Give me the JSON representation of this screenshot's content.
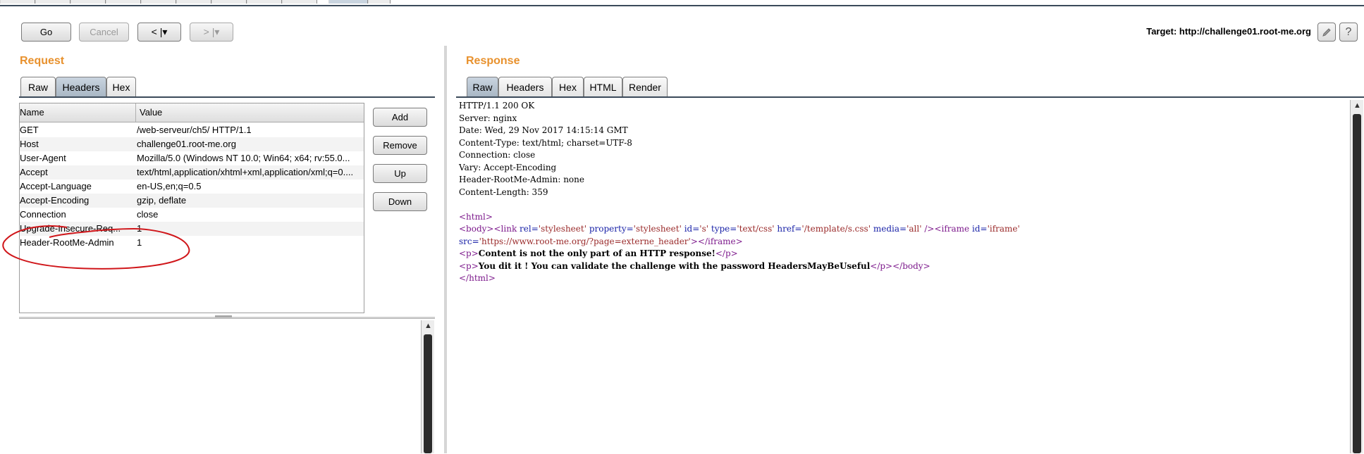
{
  "toolbar": {
    "go": "Go",
    "cancel": "Cancel",
    "back": "< |▾",
    "forward": "> |▾",
    "target_label": "Target: http://challenge01.root-me.org",
    "edit_icon": "pencil-icon",
    "help": "?"
  },
  "request": {
    "title": "Request",
    "tabs": [
      "Raw",
      "Headers",
      "Hex"
    ],
    "active_tab": "Headers",
    "columns": [
      "Name",
      "Value"
    ],
    "rows": [
      {
        "name": "GET",
        "value": "/web-serveur/ch5/ HTTP/1.1"
      },
      {
        "name": "Host",
        "value": "challenge01.root-me.org"
      },
      {
        "name": "User-Agent",
        "value": "Mozilla/5.0 (Windows NT 10.0; Win64; x64; rv:55.0..."
      },
      {
        "name": "Accept",
        "value": "text/html,application/xhtml+xml,application/xml;q=0...."
      },
      {
        "name": "Accept-Language",
        "value": "en-US,en;q=0.5"
      },
      {
        "name": "Accept-Encoding",
        "value": "gzip, deflate"
      },
      {
        "name": "Connection",
        "value": "close"
      },
      {
        "name": "Upgrade-Insecure-Req...",
        "value": "1"
      },
      {
        "name": "Header-RootMe-Admin",
        "value": "1"
      }
    ],
    "buttons": [
      "Add",
      "Remove",
      "Up",
      "Down"
    ]
  },
  "response": {
    "title": "Response",
    "tabs": [
      "Raw",
      "Headers",
      "Hex",
      "HTML",
      "Render"
    ],
    "active_tab": "Raw",
    "headers": [
      "HTTP/1.1 200 OK",
      "Server: nginx",
      "Date: Wed, 29 Nov 2017 14:15:14 GMT",
      "Content-Type: text/html; charset=UTF-8",
      "Connection: close",
      "Vary: Accept-Encoding",
      "Header-RootMe-Admin: none",
      "Content-Length: 359"
    ],
    "body": {
      "html_open": "<html>",
      "body_tag": "<body>",
      "link_open": "<link",
      "rel_attr": "rel=",
      "rel_val": "'stylesheet'",
      "property_attr": "property=",
      "property_val": "'stylesheet'",
      "id_attr": "id=",
      "id_val": "'s'",
      "type_attr": "type=",
      "type_val": "'text/css'",
      "href_attr": "href=",
      "href_val": "'/template/s.css'",
      "media_attr": "media=",
      "media_val": "'all'",
      "link_close": "/>",
      "iframe_open": "<iframe",
      "iframe_id_attr": "id=",
      "iframe_id_val": "'iframe'",
      "src_attr": "src=",
      "src_val": "'https://www.root-me.org/?page=externe_header'",
      "src_close": ">",
      "iframe_close": "</iframe>",
      "p_open": "<p>",
      "p_close": "</p>",
      "line1_text": "Content is not the only part of an HTTP response!",
      "line2_text": "You dit it ! You can validate the challenge with the password HeadersMayBeUseful",
      "body_close": "</body>",
      "html_close": "</html>"
    }
  },
  "colors": {
    "section_title": "#e8912d",
    "tag": "#7d1a8c",
    "attr": "#1a23a8",
    "value": "#9a2a2a",
    "annotation": "#d0161a"
  }
}
